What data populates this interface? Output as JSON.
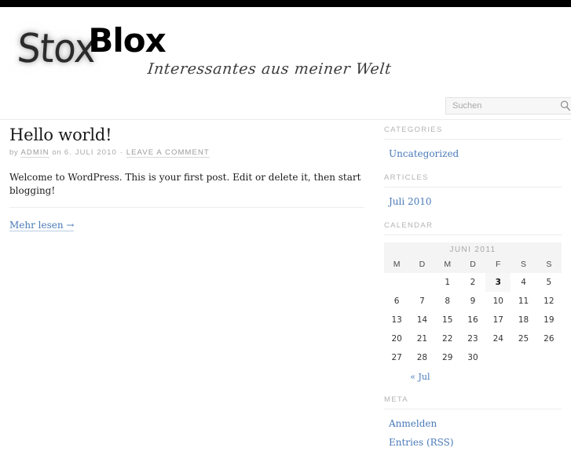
{
  "site": {
    "logo_primary": "Stox",
    "logo_secondary": "Blox",
    "tagline": "Interessantes aus meiner Welt"
  },
  "search": {
    "placeholder": "Suchen",
    "value": "",
    "icon": "search-icon"
  },
  "post": {
    "title": "Hello world!",
    "meta_by": "by",
    "meta_author": "ADMIN",
    "meta_on": "on",
    "meta_date": "6. JULI 2010",
    "meta_separator": "·",
    "meta_comments": "LEAVE A COMMENT",
    "body": "Welcome to WordPress. This is your first post. Edit or delete it, then start blogging!",
    "more_link": "Mehr lesen →"
  },
  "sidebar": {
    "categories": {
      "title": "CATEGORIES",
      "items": [
        {
          "label": "Uncategorized"
        }
      ]
    },
    "articles": {
      "title": "ARTICLES",
      "items": [
        {
          "label": "Juli 2010"
        }
      ]
    },
    "calendar": {
      "title": "CALENDAR",
      "caption": "JUNI 2011",
      "weekdays": [
        "M",
        "D",
        "M",
        "D",
        "F",
        "S",
        "S"
      ],
      "today": 3,
      "weeks": [
        [
          "",
          "",
          "1",
          "2",
          "3",
          "4",
          "5"
        ],
        [
          "6",
          "7",
          "8",
          "9",
          "10",
          "11",
          "12"
        ],
        [
          "13",
          "14",
          "15",
          "16",
          "17",
          "18",
          "19"
        ],
        [
          "20",
          "21",
          "22",
          "23",
          "24",
          "25",
          "26"
        ],
        [
          "27",
          "28",
          "29",
          "30",
          "",
          "",
          ""
        ]
      ],
      "prev_link": "« Jul"
    },
    "meta": {
      "title": "META",
      "items": [
        {
          "label": "Anmelden"
        },
        {
          "label": "Entries (RSS)"
        }
      ]
    }
  },
  "colors": {
    "link": "#4a7ab8",
    "topbar": "#000000",
    "muted": "#a9a9a9",
    "calendar_header_bg": "#f4f4f4"
  }
}
